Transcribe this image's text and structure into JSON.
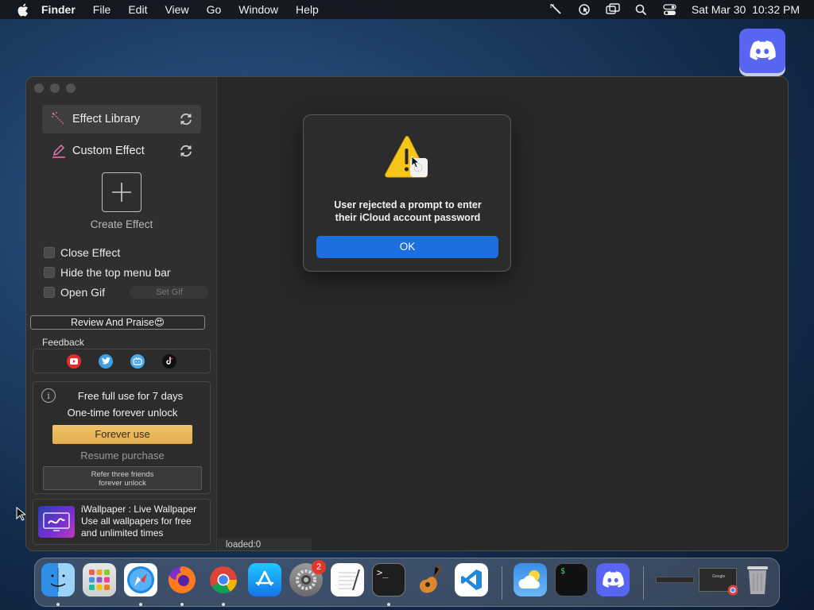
{
  "menubar": {
    "app_name": "Finder",
    "items": [
      "File",
      "Edit",
      "View",
      "Go",
      "Window",
      "Help"
    ],
    "datetime": "Sat Mar 30  10:32 PM"
  },
  "sidebar": {
    "effect_library": "Effect Library",
    "custom_effect": "Custom Effect",
    "create_effect": "Create Effect",
    "options": {
      "close_effect": "Close Effect",
      "hide_menu_bar": "Hide the top menu bar",
      "open_gif": "Open Gif",
      "set_gif": "Set Gif"
    },
    "review_button": "Review And Praise😍",
    "feedback_label": "Feedback",
    "trial": {
      "line1": "Free full use for 7 days",
      "line2": "One-time forever unlock",
      "forever_button": "Forever use",
      "resume": "Resume purchase",
      "refer_line1": "Refer three friends",
      "refer_line2": "forever unlock"
    },
    "promo": {
      "title": "iWallpaper : Live Wallpaper",
      "line1": "Use all wallpapers for free",
      "line2": "and unlimited times"
    }
  },
  "status": {
    "loaded": "loaded:0"
  },
  "dialog": {
    "line1": "User rejected a prompt to enter",
    "line2": "their iCloud account password",
    "ok": "OK"
  },
  "dock": {
    "settings_badge": "2",
    "terminal_prompt": ">_",
    "mini_terminal_text": "$",
    "google_label": "Google"
  },
  "colors": {
    "accent_blue": "#1d6ee0",
    "forever_gold": "#e8b757",
    "discord": "#5865f2"
  }
}
